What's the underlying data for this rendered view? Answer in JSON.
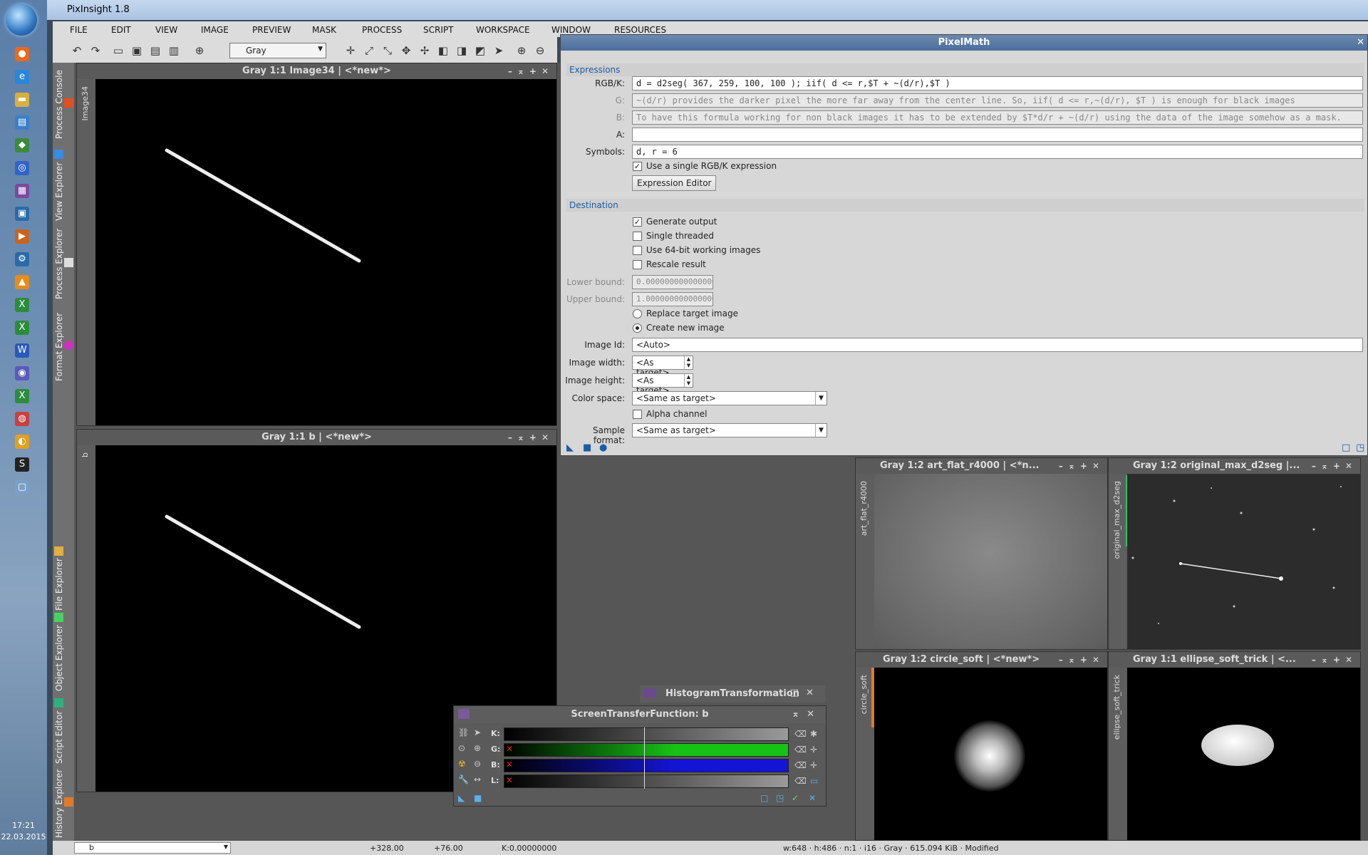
{
  "app": {
    "title": "PixInsight 1.8"
  },
  "taskbar": {
    "time": "17:21",
    "date": "22.03.2015"
  },
  "menu": [
    "FILE",
    "EDIT",
    "VIEW",
    "IMAGE",
    "PREVIEW",
    "MASK",
    "PROCESS",
    "SCRIPT",
    "WORKSPACE",
    "WINDOW",
    "RESOURCES"
  ],
  "toolbar": {
    "colorspace_select": "Gray"
  },
  "left_dock_tabs": [
    "Process Console",
    "View Explorer",
    "Process Explorer",
    "Format Explorer",
    "File Explorer",
    "Object Explorer",
    "Script Editor",
    "History Explorer"
  ],
  "windows": {
    "image34": {
      "title": "Gray 1:1 Image34 | <*new*>",
      "side": "Image34"
    },
    "b": {
      "title": "Gray 1:1 b | <*new*>",
      "side": "b"
    },
    "art_flat": {
      "title": "Gray 1:2 art_flat_r4000 | <*n...",
      "side": "art_flat_r4000"
    },
    "original_max": {
      "title": "Gray 1:2 original_max_d2seg |...",
      "side": "original_max_d2seg"
    },
    "circle_soft": {
      "title": "Gray 1:2 circle_soft | <*new*>",
      "side": "circle_soft"
    },
    "ellipse": {
      "title": "Gray 1:1 ellipse_soft_trick | <...",
      "side": "ellipse_soft_trick"
    }
  },
  "pixelmath": {
    "title": "PixelMath",
    "expressions_section": "Expressions",
    "rgbk_label": "RGB/K:",
    "rgbk_value": "d = d2seg( 367, 259, 100, 100 ); iif( d <= r,$T + ~(d/r),$T )",
    "g_label": "G:",
    "g_value": "~(d/r) provides the darker pixel the more far away from the center line. So, iif( d <= r,~(d/r), $T ) is enough for black images",
    "b_label": "B:",
    "b_value": "To have this formula working for non black images it has to be extended by      $T*d/r + ~(d/r)  using the data of the image somehow as a mask.",
    "a_label": "A:",
    "a_value": "",
    "symbols_label": "Symbols:",
    "symbols_value": "d, r = 6",
    "single_expr": "Use a single RGB/K expression",
    "expr_editor": "Expression Editor",
    "destination_section": "Destination",
    "generate_output": "Generate output",
    "single_threaded": "Single threaded",
    "use64": "Use 64-bit working images",
    "rescale": "Rescale result",
    "lower_label": "Lower bound:",
    "lower_value": "0.000000000000000",
    "upper_label": "Upper bound:",
    "upper_value": "1.000000000000000",
    "replace_target": "Replace target image",
    "create_new": "Create new image",
    "image_id_label": "Image Id:",
    "image_id_value": "<Auto>",
    "width_label": "Image width:",
    "width_value": "<As target>",
    "height_label": "Image height:",
    "height_value": "<As target>",
    "colorspace_label": "Color space:",
    "colorspace_value": "<Same as target>",
    "alpha": "Alpha channel",
    "sample_label": "Sample format:",
    "sample_value": "<Same as target>"
  },
  "histogram": {
    "title": "HistogramTransformation"
  },
  "stf": {
    "title": "ScreenTransferFunction: b",
    "channels": [
      "K:",
      "G:",
      "B:",
      "L:"
    ],
    "colors": [
      "#9a9a9a",
      "#17c217",
      "#1414d6",
      "#9a9a9a"
    ]
  },
  "status": {
    "view": "b",
    "x": "+328.00",
    "y": "+76.00",
    "k": "K:0.00000000",
    "info": "w:648 · h:486 · n:1 · i16 · Gray · 615.094 KiB · Modified"
  }
}
